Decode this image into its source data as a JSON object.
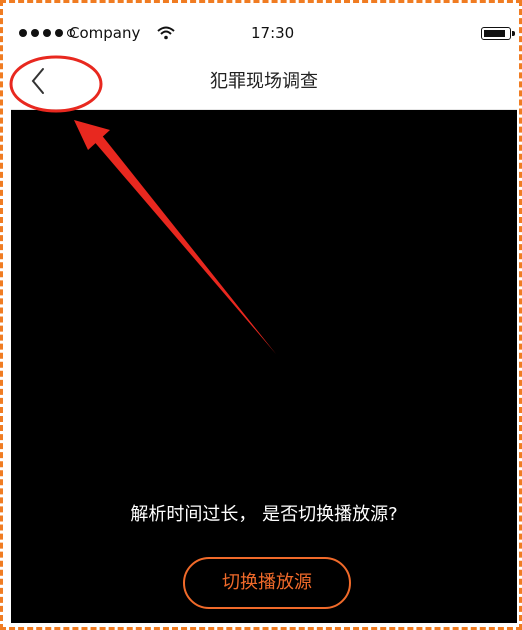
{
  "status_bar": {
    "carrier": "Company",
    "time": "17:30",
    "signal_dots_filled": 4,
    "signal_dots_total": 5,
    "battery_level": 0.9
  },
  "nav_bar": {
    "title": "犯罪现场调查",
    "back_icon": "chevron-left-icon"
  },
  "player": {
    "prompt": "解析时间过长，  是否切换播放源?",
    "switch_button_label": "切换播放源"
  },
  "colors": {
    "accent": "#f06a2a",
    "annotation": "#e8281f",
    "frame_border": "#f07c22",
    "video_background": "#000000"
  }
}
